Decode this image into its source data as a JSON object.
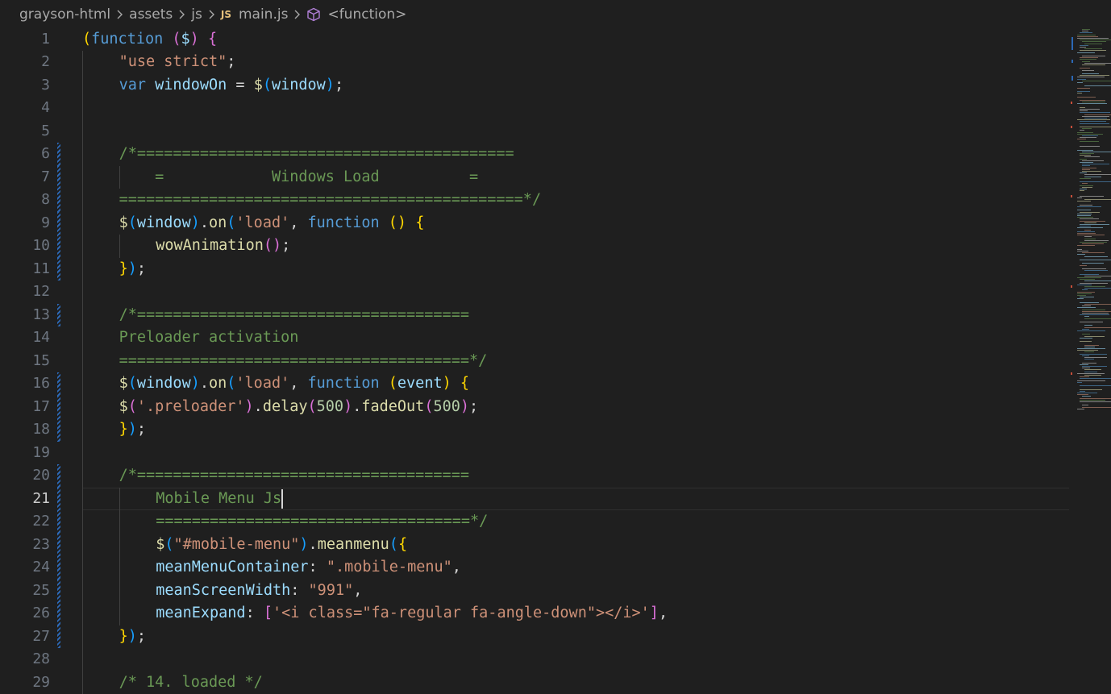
{
  "breadcrumb": {
    "items": [
      "grayson-html",
      "assets",
      "js",
      "main.js",
      "<function>"
    ],
    "file_badge": "JS",
    "separator_icon": "chevron-right-icon",
    "symbol_icon": "cube-icon"
  },
  "editor": {
    "current_line": 21,
    "lines": [
      {
        "n": 1,
        "indent": 0,
        "tokens": [
          [
            "(",
            "b1"
          ],
          [
            "function",
            "kw"
          ],
          [
            " ",
            "p"
          ],
          [
            "(",
            "b2"
          ],
          [
            "$",
            "var"
          ],
          [
            ")",
            "b2"
          ],
          [
            " ",
            "p"
          ],
          [
            "{",
            "b2"
          ]
        ]
      },
      {
        "n": 2,
        "indent": 1,
        "tokens": [
          [
            "\"use strict\"",
            "str"
          ],
          [
            ";",
            "p"
          ]
        ]
      },
      {
        "n": 3,
        "indent": 1,
        "tokens": [
          [
            "var",
            "kw"
          ],
          [
            " ",
            "p"
          ],
          [
            "windowOn",
            "var"
          ],
          [
            " = ",
            "p"
          ],
          [
            "$",
            "fn"
          ],
          [
            "(",
            "b3"
          ],
          [
            "window",
            "var"
          ],
          [
            ")",
            "b3"
          ],
          [
            ";",
            "p"
          ]
        ]
      },
      {
        "n": 4,
        "indent": 0,
        "tokens": []
      },
      {
        "n": 5,
        "indent": 0,
        "tokens": []
      },
      {
        "n": 6,
        "indent": 1,
        "tokens": [
          [
            "/*==========================================",
            "cm"
          ]
        ]
      },
      {
        "n": 7,
        "indent": 1,
        "tokens": [
          [
            "    =            Windows Load          =",
            "cm"
          ]
        ]
      },
      {
        "n": 8,
        "indent": 1,
        "tokens": [
          [
            "=============================================*/",
            "cm"
          ]
        ]
      },
      {
        "n": 9,
        "indent": 1,
        "tokens": [
          [
            "$",
            "fn"
          ],
          [
            "(",
            "b3"
          ],
          [
            "window",
            "var"
          ],
          [
            ")",
            "b3"
          ],
          [
            ".",
            "p"
          ],
          [
            "on",
            "fn"
          ],
          [
            "(",
            "b3"
          ],
          [
            "'load'",
            "str"
          ],
          [
            ", ",
            "p"
          ],
          [
            "function",
            "kw"
          ],
          [
            " ",
            "p"
          ],
          [
            "()",
            "b1"
          ],
          [
            " ",
            "p"
          ],
          [
            "{",
            "b1"
          ]
        ]
      },
      {
        "n": 10,
        "indent": 2,
        "tokens": [
          [
            "wowAnimation",
            "fn"
          ],
          [
            "()",
            "b2"
          ],
          [
            ";",
            "p"
          ]
        ]
      },
      {
        "n": 11,
        "indent": 1,
        "tokens": [
          [
            "}",
            "b1"
          ],
          [
            ")",
            "b3"
          ],
          [
            ";",
            "p"
          ]
        ]
      },
      {
        "n": 12,
        "indent": 0,
        "tokens": []
      },
      {
        "n": 13,
        "indent": 1,
        "tokens": [
          [
            "/*=====================================",
            "cm"
          ]
        ]
      },
      {
        "n": 14,
        "indent": 1,
        "tokens": [
          [
            "Preloader activation",
            "cm"
          ]
        ]
      },
      {
        "n": 15,
        "indent": 1,
        "tokens": [
          [
            "=======================================*/",
            "cm"
          ]
        ]
      },
      {
        "n": 16,
        "indent": 1,
        "tokens": [
          [
            "$",
            "fn"
          ],
          [
            "(",
            "b3"
          ],
          [
            "window",
            "var"
          ],
          [
            ")",
            "b3"
          ],
          [
            ".",
            "p"
          ],
          [
            "on",
            "fn"
          ],
          [
            "(",
            "b3"
          ],
          [
            "'load'",
            "str"
          ],
          [
            ", ",
            "p"
          ],
          [
            "function",
            "kw"
          ],
          [
            " ",
            "p"
          ],
          [
            "(",
            "b1"
          ],
          [
            "event",
            "var"
          ],
          [
            ")",
            "b1"
          ],
          [
            " ",
            "p"
          ],
          [
            "{",
            "b1"
          ]
        ]
      },
      {
        "n": 17,
        "indent": 1,
        "tokens": [
          [
            "$",
            "fn"
          ],
          [
            "(",
            "b2"
          ],
          [
            "'.preloader'",
            "str"
          ],
          [
            ")",
            "b2"
          ],
          [
            ".",
            "p"
          ],
          [
            "delay",
            "fn"
          ],
          [
            "(",
            "b2"
          ],
          [
            "500",
            "num"
          ],
          [
            ")",
            "b2"
          ],
          [
            ".",
            "p"
          ],
          [
            "fadeOut",
            "fn"
          ],
          [
            "(",
            "b2"
          ],
          [
            "500",
            "num"
          ],
          [
            ")",
            "b2"
          ],
          [
            ";",
            "p"
          ]
        ]
      },
      {
        "n": 18,
        "indent": 1,
        "tokens": [
          [
            "}",
            "b1"
          ],
          [
            ")",
            "b3"
          ],
          [
            ";",
            "p"
          ]
        ]
      },
      {
        "n": 19,
        "indent": 0,
        "tokens": []
      },
      {
        "n": 20,
        "indent": 1,
        "tokens": [
          [
            "/*=====================================",
            "cm"
          ]
        ]
      },
      {
        "n": 21,
        "indent": 2,
        "tokens": [
          [
            "Mobile Menu Js",
            "cm"
          ]
        ]
      },
      {
        "n": 22,
        "indent": 2,
        "tokens": [
          [
            "===================================*/",
            "cm"
          ]
        ]
      },
      {
        "n": 23,
        "indent": 2,
        "tokens": [
          [
            "$",
            "fn"
          ],
          [
            "(",
            "b3"
          ],
          [
            "\"#mobile-menu\"",
            "str"
          ],
          [
            ")",
            "b3"
          ],
          [
            ".",
            "p"
          ],
          [
            "meanmenu",
            "fn"
          ],
          [
            "(",
            "b3"
          ],
          [
            "{",
            "b1"
          ]
        ]
      },
      {
        "n": 24,
        "indent": 2,
        "tokens": [
          [
            "meanMenuContainer",
            "var"
          ],
          [
            ": ",
            "p"
          ],
          [
            "\".mobile-menu\"",
            "str"
          ],
          [
            ",",
            "p"
          ]
        ]
      },
      {
        "n": 25,
        "indent": 2,
        "tokens": [
          [
            "meanScreenWidth",
            "var"
          ],
          [
            ": ",
            "p"
          ],
          [
            "\"991\"",
            "str"
          ],
          [
            ",",
            "p"
          ]
        ]
      },
      {
        "n": 26,
        "indent": 2,
        "tokens": [
          [
            "meanExpand",
            "var"
          ],
          [
            ": ",
            "p"
          ],
          [
            "[",
            "b2"
          ],
          [
            "'<i class=\"fa-regular fa-angle-down\"></i>'",
            "str"
          ],
          [
            "]",
            "b2"
          ],
          [
            ",",
            "p"
          ]
        ]
      },
      {
        "n": 27,
        "indent": 1,
        "tokens": [
          [
            "}",
            "b1"
          ],
          [
            ")",
            "b3"
          ],
          [
            ";",
            "p"
          ]
        ]
      },
      {
        "n": 28,
        "indent": 0,
        "tokens": []
      },
      {
        "n": 29,
        "indent": 1,
        "tokens": [
          [
            "/* 14. loaded */",
            "cm"
          ]
        ]
      }
    ],
    "modified_lines": [
      6,
      7,
      8,
      9,
      10,
      11,
      13,
      16,
      17,
      18,
      20,
      21,
      22,
      23,
      24,
      25,
      26,
      27
    ]
  },
  "colors": {
    "keyword": "#569cd6",
    "string": "#ce9178",
    "comment": "#6a9955",
    "function": "#dcdcaa",
    "variable": "#9cdcfe",
    "number": "#b5cea8",
    "bracket_gold": "#ffd700",
    "bracket_orchid": "#da70d6",
    "bracket_blue": "#179fff",
    "modified_bar": "#2c68b5",
    "background": "#1f1f1f"
  }
}
